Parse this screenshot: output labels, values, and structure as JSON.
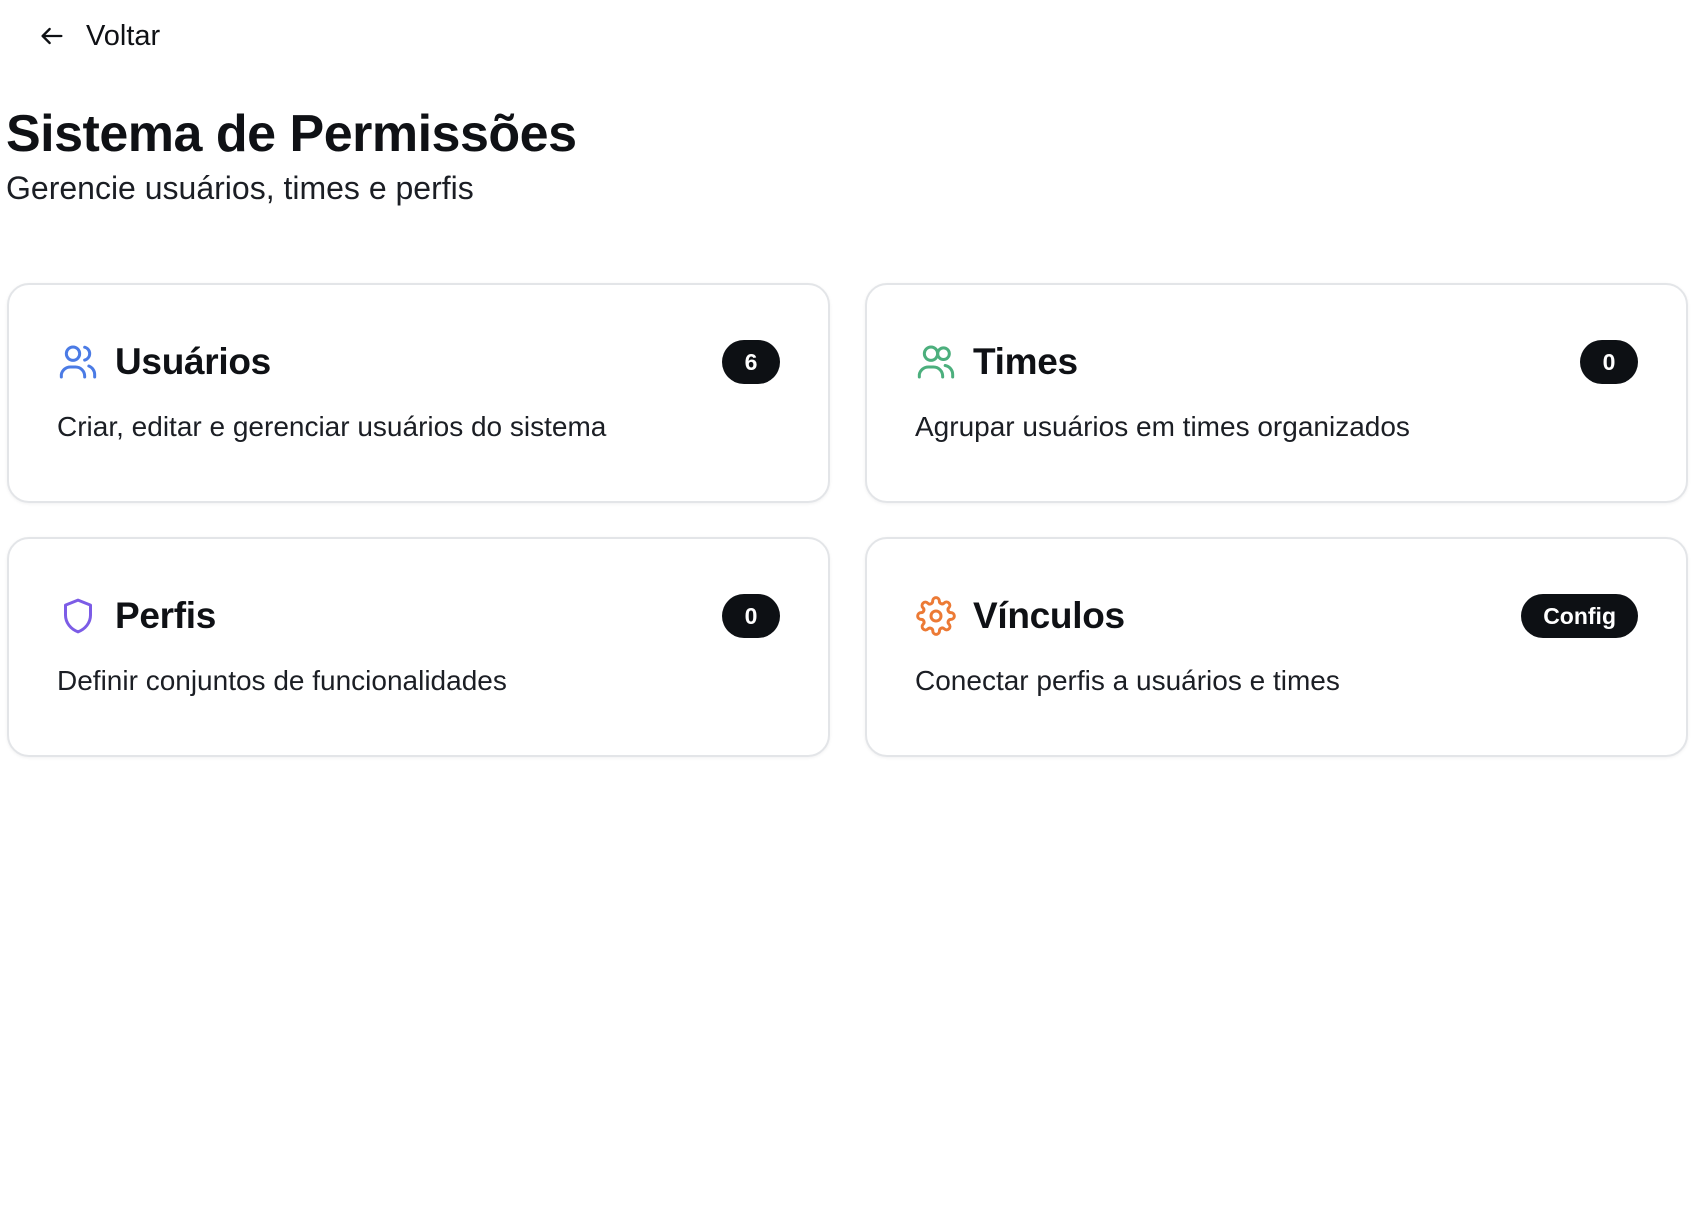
{
  "nav": {
    "back_label": "Voltar"
  },
  "header": {
    "title": "Sistema de Permissões",
    "subtitle": "Gerencie usuários, times e perfis"
  },
  "cards": [
    {
      "title": "Usuários",
      "badge": "6",
      "description": "Criar, editar e gerenciar usuários do sistema",
      "icon": "users-icon",
      "icon_color": "#4b7be5"
    },
    {
      "title": "Times",
      "badge": "0",
      "description": "Agrupar usuários em times organizados",
      "icon": "team-icon",
      "icon_color": "#4caf7d"
    },
    {
      "title": "Perfis",
      "badge": "0",
      "description": "Definir conjuntos de funcionalidades",
      "icon": "shield-icon",
      "icon_color": "#7c5ce6"
    },
    {
      "title": "Vínculos",
      "badge": "Config",
      "description": "Conectar perfis a usuários e times",
      "icon": "gear-icon",
      "icon_color": "#ec7a35"
    }
  ]
}
